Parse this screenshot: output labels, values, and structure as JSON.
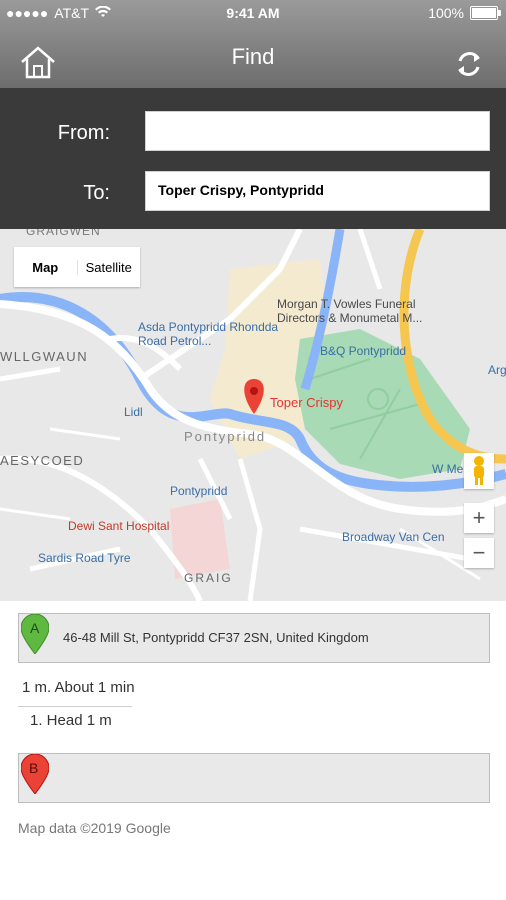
{
  "status_bar": {
    "carrier": "AT&T",
    "time": "9:41 AM",
    "battery": "100%"
  },
  "header": {
    "title": "Find"
  },
  "form": {
    "from_label": "From:",
    "from_value": "",
    "to_label": "To:",
    "to_value": "Toper Crispy, Pontypridd"
  },
  "map": {
    "tabs": [
      "Map",
      "Satellite"
    ],
    "zoom_in": "+",
    "zoom_out": "−",
    "labels": {
      "graigwen": "GRAIGWEN",
      "wllgwaun": "WLLGWAUN",
      "aesycoed": "AESYCOED",
      "graig": "GRAIG",
      "pontypridd_town": "Pontypridd",
      "asda": "Asda Pontypridd Rhondda Road Petrol...",
      "morgan": "Morgan T. Vowles Funeral Directors & Monumetal M...",
      "bq": "B&Q Pontypridd",
      "lidl": "Lidl",
      "toper": "Toper Crispy",
      "pontypridd_station": "Pontypridd",
      "dewi": "Dewi Sant Hospital",
      "sardis": "Sardis Road Tyre",
      "broadway": "Broadway Van Cen",
      "wme": "W Me",
      "arg": "Arg"
    }
  },
  "directions": {
    "start_marker": "A",
    "start_address": "46-48 Mill St, Pontypridd CF37 2SN, United Kingdom",
    "summary": "1 m. About 1 min",
    "step": "1.  Head  1 m",
    "end_marker": "B",
    "end_address": "",
    "copyright": "Map data ©2019 Google"
  },
  "colors": {
    "header_top": "#9a9a9a",
    "panel": "#3a3a3a",
    "road": "#ffffff",
    "river": "#8ab4f8",
    "park": "#a8dab5",
    "marker_green": "#5fb840",
    "marker_red": "#ea4335"
  }
}
